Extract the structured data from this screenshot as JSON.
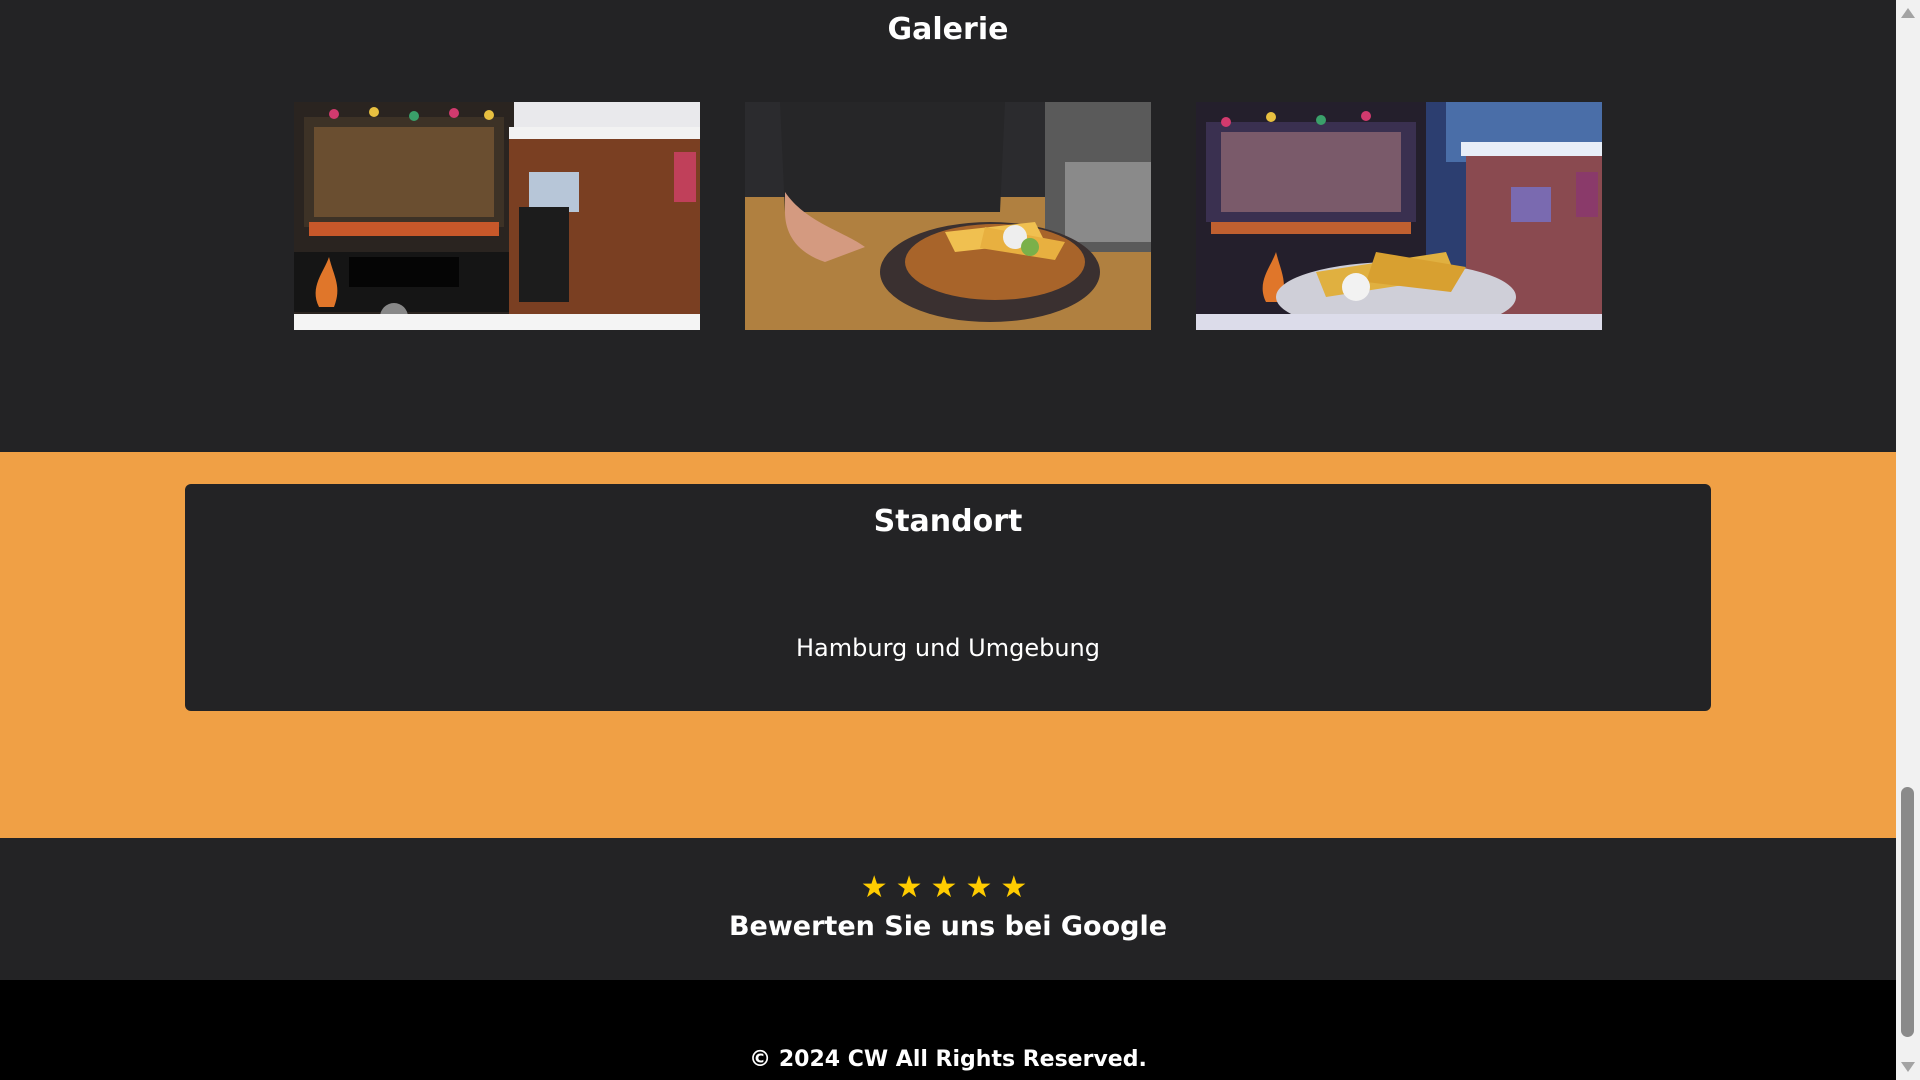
{
  "gallery": {
    "title": "Galerie",
    "images": [
      {
        "alt": "Food truck in the snow"
      },
      {
        "alt": "Schnitzel with fries"
      },
      {
        "alt": "Fries plate in front of food truck"
      }
    ]
  },
  "location": {
    "title": "Standort",
    "text": "Hamburg und Umgebung"
  },
  "rating": {
    "stars": [
      "★",
      "★",
      "★",
      "★",
      "★"
    ],
    "star_count": 5,
    "label": "Bewerten Sie uns bei Google",
    "star_color": "#ffcc00"
  },
  "footer": {
    "copyright": "© 2024 CW All Rights Reserved."
  },
  "colors": {
    "dark_background": "#232325",
    "accent_orange": "#f0a045",
    "footer_background": "#000000"
  }
}
